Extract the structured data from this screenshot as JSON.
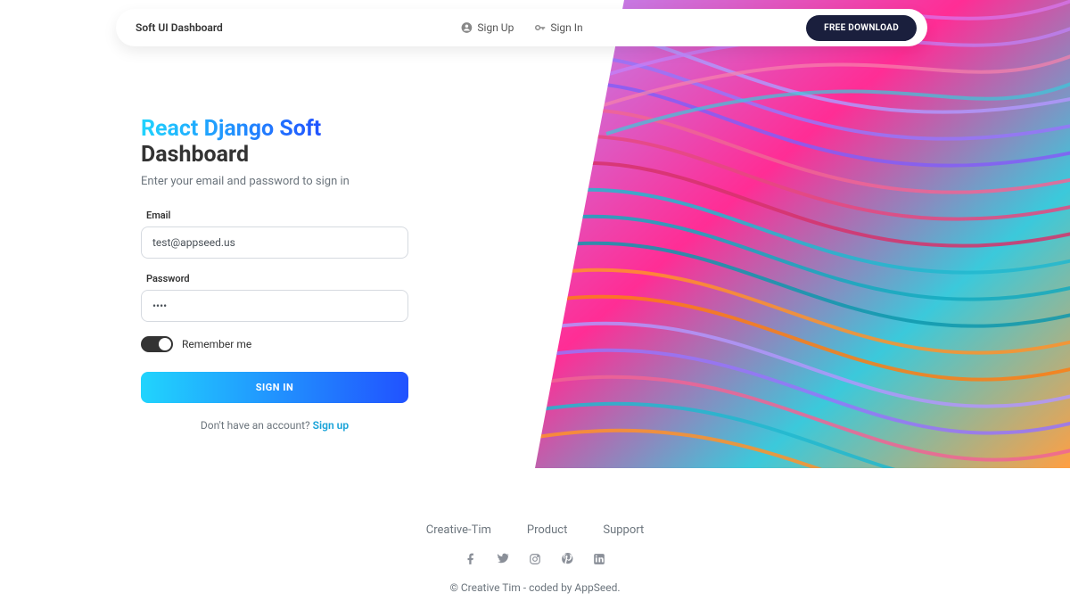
{
  "nav": {
    "brand": "Soft UI Dashboard",
    "signup": "Sign Up",
    "signin": "Sign In",
    "download": "FREE DOWNLOAD"
  },
  "form": {
    "title_gradient": "React Django Soft",
    "title_plain": "Dashboard",
    "subtitle": "Enter your email and password to sign in",
    "email_label": "Email",
    "email_value": "test@appseed.us",
    "password_label": "Password",
    "password_value": "pass",
    "remember_label": "Remember me",
    "submit_label": "SIGN IN",
    "no_account_text": "Don't have an account? ",
    "signup_link": "Sign up"
  },
  "footer": {
    "links": [
      "Creative-Tim",
      "Product",
      "Support"
    ],
    "copyright": "© Creative Tim - coded by AppSeed."
  }
}
